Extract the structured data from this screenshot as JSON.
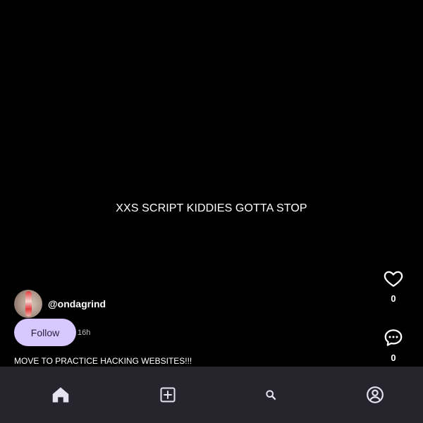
{
  "post": {
    "text": "XXS SCRIPT KIDDIES GOTTA STOP",
    "author": "@ondagrind",
    "time": "16h",
    "caption": "MOVE TO PRACTICE HACKING WEBSITES!!!",
    "follow_label": "Follow",
    "likes": "0",
    "comments": "0"
  },
  "nav": {
    "items": [
      {
        "icon": "home-icon",
        "active": true
      },
      {
        "icon": "add-post-icon",
        "active": false
      },
      {
        "icon": "search-icon",
        "active": false
      },
      {
        "icon": "profile-icon",
        "active": false
      }
    ]
  },
  "colors": {
    "background": "#000000",
    "follow_button": "#d8c8ff",
    "nav_background": "#26242c",
    "icon": "#e6e3f0"
  }
}
